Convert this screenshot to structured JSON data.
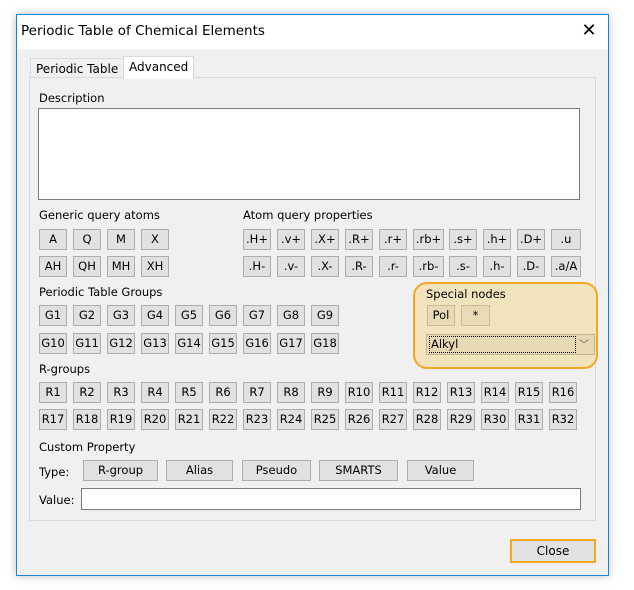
{
  "window": {
    "title": "Periodic Table of Chemical Elements",
    "close_icon": "close-icon"
  },
  "tabs": [
    {
      "label": "Periodic Table",
      "active": false
    },
    {
      "label": "Advanced",
      "active": true
    }
  ],
  "description": {
    "label": "Description",
    "value": ""
  },
  "generic_query_atoms": {
    "label": "Generic query atoms",
    "row1": [
      "A",
      "Q",
      "M",
      "X"
    ],
    "row2": [
      "AH",
      "QH",
      "MH",
      "XH"
    ]
  },
  "atom_query_properties": {
    "label": "Atom query properties",
    "row1": [
      ".H+",
      ".v+",
      ".X+",
      ".R+",
      ".r+",
      ".rb+",
      ".s+",
      ".h+",
      ".D+",
      ".u"
    ],
    "row2": [
      ".H-",
      ".v-",
      ".X-",
      ".R-",
      ".r-",
      ".rb-",
      ".s-",
      ".h-",
      ".D-",
      ".a/A"
    ]
  },
  "periodic_table_groups": {
    "label": "Periodic Table Groups",
    "row1": [
      "G1",
      "G2",
      "G3",
      "G4",
      "G5",
      "G6",
      "G7",
      "G8",
      "G9"
    ],
    "row2": [
      "G10",
      "G11",
      "G12",
      "G13",
      "G14",
      "G15",
      "G16",
      "G17",
      "G18"
    ]
  },
  "special_nodes": {
    "label": "Special nodes",
    "buttons": [
      "Pol",
      "*"
    ],
    "dropdown_value": "Alkyl",
    "highlight_color": "#f5a623"
  },
  "r_groups": {
    "label": "R-groups",
    "row1": [
      "R1",
      "R2",
      "R3",
      "R4",
      "R5",
      "R6",
      "R7",
      "R8",
      "R9",
      "R10",
      "R11",
      "R12",
      "R13",
      "R14",
      "R15",
      "R16"
    ],
    "row2": [
      "R17",
      "R18",
      "R19",
      "R20",
      "R21",
      "R22",
      "R23",
      "R24",
      "R25",
      "R26",
      "R27",
      "R28",
      "R29",
      "R30",
      "R31",
      "R32"
    ]
  },
  "custom_property": {
    "label": "Custom Property",
    "type_label": "Type:",
    "type_buttons": [
      "R-group",
      "Alias",
      "Pseudo",
      "SMARTS",
      "Value"
    ],
    "value_label": "Value:",
    "value": ""
  },
  "footer": {
    "close_label": "Close"
  }
}
